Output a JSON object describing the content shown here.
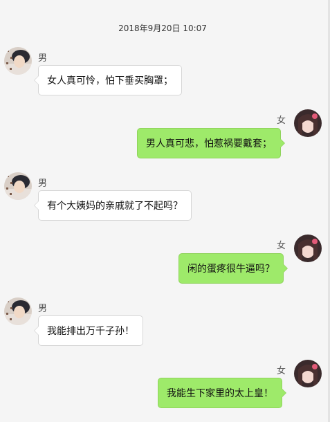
{
  "timestamp": "2018年9月20日 10:07",
  "male_avatar_icon": "male-avatar-icon",
  "female_avatar_icon": "female-avatar-icon",
  "messages": [
    {
      "sender": "男",
      "side": "left",
      "text": "女人真可怜，怕下垂买胸罩；"
    },
    {
      "sender": "女",
      "side": "right",
      "text": "男人真可悲，怕惹祸要戴套；"
    },
    {
      "sender": "男",
      "side": "left",
      "text": "有个大姨妈的亲戚就了不起吗？"
    },
    {
      "sender": "女",
      "side": "right",
      "text": "闲的蛋疼很牛逼吗？"
    },
    {
      "sender": "男",
      "side": "left",
      "text": "我能排出万千子孙！"
    },
    {
      "sender": "女",
      "side": "right",
      "text": "我能生下家里的太上皇！"
    }
  ],
  "colors": {
    "background": "#f5f5f5",
    "left_bubble": "#ffffff",
    "right_bubble": "#9eea6a"
  }
}
